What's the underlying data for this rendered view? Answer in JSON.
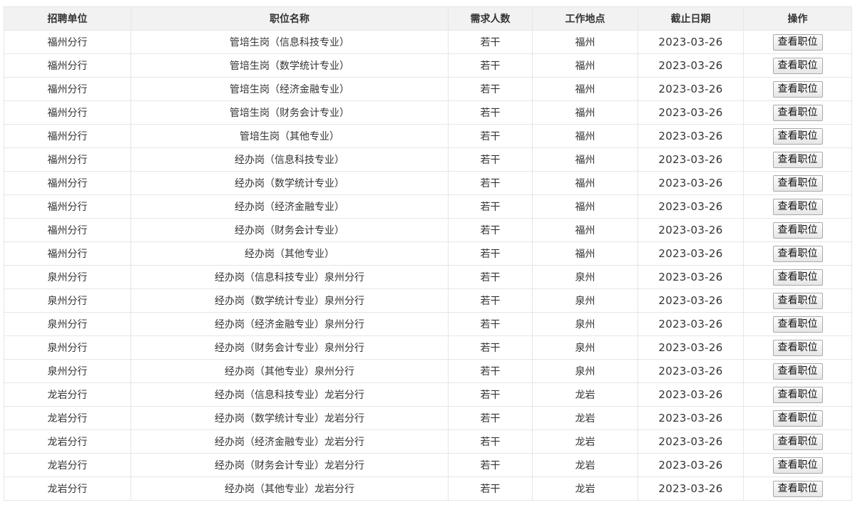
{
  "table": {
    "headers": [
      "招聘单位",
      "职位名称",
      "需求人数",
      "工作地点",
      "截止日期",
      "操作"
    ],
    "rows": [
      {
        "unit": "福州分行",
        "position": "管培生岗（信息科技专业）",
        "count": "若干",
        "location": "福州",
        "deadline": "2023-03-26",
        "action": "查看职位"
      },
      {
        "unit": "福州分行",
        "position": "管培生岗（数学统计专业）",
        "count": "若干",
        "location": "福州",
        "deadline": "2023-03-26",
        "action": "查看职位"
      },
      {
        "unit": "福州分行",
        "position": "管培生岗（经济金融专业）",
        "count": "若干",
        "location": "福州",
        "deadline": "2023-03-26",
        "action": "查看职位"
      },
      {
        "unit": "福州分行",
        "position": "管培生岗（财务会计专业）",
        "count": "若干",
        "location": "福州",
        "deadline": "2023-03-26",
        "action": "查看职位"
      },
      {
        "unit": "福州分行",
        "position": "管培生岗（其他专业）",
        "count": "若干",
        "location": "福州",
        "deadline": "2023-03-26",
        "action": "查看职位"
      },
      {
        "unit": "福州分行",
        "position": "经办岗（信息科技专业）",
        "count": "若干",
        "location": "福州",
        "deadline": "2023-03-26",
        "action": "查看职位"
      },
      {
        "unit": "福州分行",
        "position": "经办岗（数学统计专业）",
        "count": "若干",
        "location": "福州",
        "deadline": "2023-03-26",
        "action": "查看职位"
      },
      {
        "unit": "福州分行",
        "position": "经办岗（经济金融专业）",
        "count": "若干",
        "location": "福州",
        "deadline": "2023-03-26",
        "action": "查看职位"
      },
      {
        "unit": "福州分行",
        "position": "经办岗（财务会计专业）",
        "count": "若干",
        "location": "福州",
        "deadline": "2023-03-26",
        "action": "查看职位"
      },
      {
        "unit": "福州分行",
        "position": "经办岗（其他专业）",
        "count": "若干",
        "location": "福州",
        "deadline": "2023-03-26",
        "action": "查看职位"
      },
      {
        "unit": "泉州分行",
        "position": "经办岗（信息科技专业）泉州分行",
        "count": "若干",
        "location": "泉州",
        "deadline": "2023-03-26",
        "action": "查看职位"
      },
      {
        "unit": "泉州分行",
        "position": "经办岗（数学统计专业）泉州分行",
        "count": "若干",
        "location": "泉州",
        "deadline": "2023-03-26",
        "action": "查看职位"
      },
      {
        "unit": "泉州分行",
        "position": "经办岗（经济金融专业）泉州分行",
        "count": "若干",
        "location": "泉州",
        "deadline": "2023-03-26",
        "action": "查看职位"
      },
      {
        "unit": "泉州分行",
        "position": "经办岗（财务会计专业）泉州分行",
        "count": "若干",
        "location": "泉州",
        "deadline": "2023-03-26",
        "action": "查看职位"
      },
      {
        "unit": "泉州分行",
        "position": "经办岗（其他专业）泉州分行",
        "count": "若干",
        "location": "泉州",
        "deadline": "2023-03-26",
        "action": "查看职位"
      },
      {
        "unit": "龙岩分行",
        "position": "经办岗（信息科技专业）龙岩分行",
        "count": "若干",
        "location": "龙岩",
        "deadline": "2023-03-26",
        "action": "查看职位"
      },
      {
        "unit": "龙岩分行",
        "position": "经办岗（数学统计专业）龙岩分行",
        "count": "若干",
        "location": "龙岩",
        "deadline": "2023-03-26",
        "action": "查看职位"
      },
      {
        "unit": "龙岩分行",
        "position": "经办岗（经济金融专业）龙岩分行",
        "count": "若干",
        "location": "龙岩",
        "deadline": "2023-03-26",
        "action": "查看职位"
      },
      {
        "unit": "龙岩分行",
        "position": "经办岗（财务会计专业）龙岩分行",
        "count": "若干",
        "location": "龙岩",
        "deadline": "2023-03-26",
        "action": "查看职位"
      },
      {
        "unit": "龙岩分行",
        "position": "经办岗（其他专业）龙岩分行",
        "count": "若干",
        "location": "龙岩",
        "deadline": "2023-03-26",
        "action": "查看职位"
      }
    ]
  },
  "colors": {
    "header_bg": "#f2f2f2",
    "border": "#e6e6e6",
    "text": "#333333"
  }
}
